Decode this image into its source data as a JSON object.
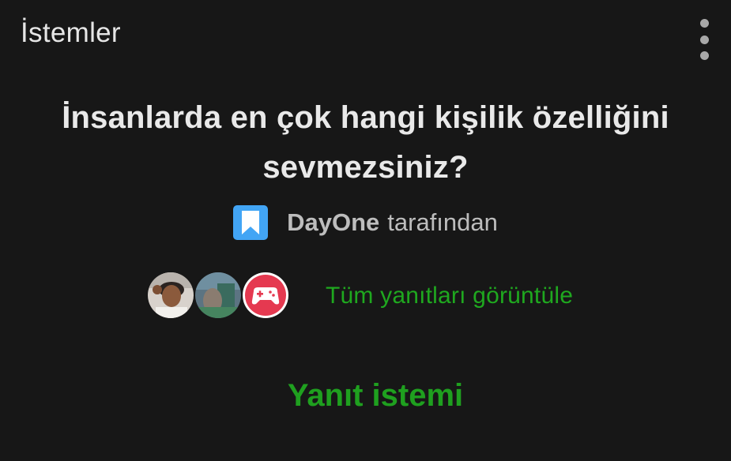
{
  "header": {
    "title": "İstemler",
    "more_icon": "more-vertical-icon"
  },
  "prompt": {
    "question": "İnsanlarda en çok hangi kişilik özelliğini sevmezsiniz?",
    "author": {
      "logo_icon": "dayone-bookmark-logo",
      "name": "DayOne",
      "suffix": "tarafından"
    },
    "responders": {
      "avatars": [
        "avatar-user-1",
        "avatar-user-2",
        "avatar-gamepad"
      ],
      "view_all_label": "Tüm yanıtları görüntüle"
    },
    "answer_button_label": "Yanıt istemi"
  },
  "colors": {
    "background": "#171717",
    "accent_green": "#1fa81f",
    "logo_blue": "#42a5f5",
    "gamepad_red": "#e53950"
  }
}
